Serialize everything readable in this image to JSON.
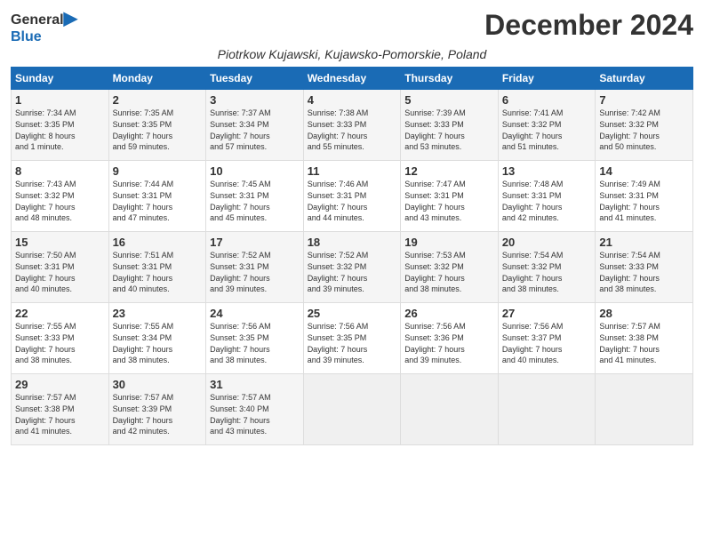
{
  "logo": {
    "line1": "General",
    "line2": "Blue"
  },
  "title": "December 2024",
  "location": "Piotrkow Kujawski, Kujawsko-Pomorskie, Poland",
  "days_of_week": [
    "Sunday",
    "Monday",
    "Tuesday",
    "Wednesday",
    "Thursday",
    "Friday",
    "Saturday"
  ],
  "weeks": [
    [
      {
        "day": "1",
        "info": "Sunrise: 7:34 AM\nSunset: 3:35 PM\nDaylight: 8 hours\nand 1 minute."
      },
      {
        "day": "2",
        "info": "Sunrise: 7:35 AM\nSunset: 3:35 PM\nDaylight: 7 hours\nand 59 minutes."
      },
      {
        "day": "3",
        "info": "Sunrise: 7:37 AM\nSunset: 3:34 PM\nDaylight: 7 hours\nand 57 minutes."
      },
      {
        "day": "4",
        "info": "Sunrise: 7:38 AM\nSunset: 3:33 PM\nDaylight: 7 hours\nand 55 minutes."
      },
      {
        "day": "5",
        "info": "Sunrise: 7:39 AM\nSunset: 3:33 PM\nDaylight: 7 hours\nand 53 minutes."
      },
      {
        "day": "6",
        "info": "Sunrise: 7:41 AM\nSunset: 3:32 PM\nDaylight: 7 hours\nand 51 minutes."
      },
      {
        "day": "7",
        "info": "Sunrise: 7:42 AM\nSunset: 3:32 PM\nDaylight: 7 hours\nand 50 minutes."
      }
    ],
    [
      {
        "day": "8",
        "info": "Sunrise: 7:43 AM\nSunset: 3:32 PM\nDaylight: 7 hours\nand 48 minutes."
      },
      {
        "day": "9",
        "info": "Sunrise: 7:44 AM\nSunset: 3:31 PM\nDaylight: 7 hours\nand 47 minutes."
      },
      {
        "day": "10",
        "info": "Sunrise: 7:45 AM\nSunset: 3:31 PM\nDaylight: 7 hours\nand 45 minutes."
      },
      {
        "day": "11",
        "info": "Sunrise: 7:46 AM\nSunset: 3:31 PM\nDaylight: 7 hours\nand 44 minutes."
      },
      {
        "day": "12",
        "info": "Sunrise: 7:47 AM\nSunset: 3:31 PM\nDaylight: 7 hours\nand 43 minutes."
      },
      {
        "day": "13",
        "info": "Sunrise: 7:48 AM\nSunset: 3:31 PM\nDaylight: 7 hours\nand 42 minutes."
      },
      {
        "day": "14",
        "info": "Sunrise: 7:49 AM\nSunset: 3:31 PM\nDaylight: 7 hours\nand 41 minutes."
      }
    ],
    [
      {
        "day": "15",
        "info": "Sunrise: 7:50 AM\nSunset: 3:31 PM\nDaylight: 7 hours\nand 40 minutes."
      },
      {
        "day": "16",
        "info": "Sunrise: 7:51 AM\nSunset: 3:31 PM\nDaylight: 7 hours\nand 40 minutes."
      },
      {
        "day": "17",
        "info": "Sunrise: 7:52 AM\nSunset: 3:31 PM\nDaylight: 7 hours\nand 39 minutes."
      },
      {
        "day": "18",
        "info": "Sunrise: 7:52 AM\nSunset: 3:32 PM\nDaylight: 7 hours\nand 39 minutes."
      },
      {
        "day": "19",
        "info": "Sunrise: 7:53 AM\nSunset: 3:32 PM\nDaylight: 7 hours\nand 38 minutes."
      },
      {
        "day": "20",
        "info": "Sunrise: 7:54 AM\nSunset: 3:32 PM\nDaylight: 7 hours\nand 38 minutes."
      },
      {
        "day": "21",
        "info": "Sunrise: 7:54 AM\nSunset: 3:33 PM\nDaylight: 7 hours\nand 38 minutes."
      }
    ],
    [
      {
        "day": "22",
        "info": "Sunrise: 7:55 AM\nSunset: 3:33 PM\nDaylight: 7 hours\nand 38 minutes."
      },
      {
        "day": "23",
        "info": "Sunrise: 7:55 AM\nSunset: 3:34 PM\nDaylight: 7 hours\nand 38 minutes."
      },
      {
        "day": "24",
        "info": "Sunrise: 7:56 AM\nSunset: 3:35 PM\nDaylight: 7 hours\nand 38 minutes."
      },
      {
        "day": "25",
        "info": "Sunrise: 7:56 AM\nSunset: 3:35 PM\nDaylight: 7 hours\nand 39 minutes."
      },
      {
        "day": "26",
        "info": "Sunrise: 7:56 AM\nSunset: 3:36 PM\nDaylight: 7 hours\nand 39 minutes."
      },
      {
        "day": "27",
        "info": "Sunrise: 7:56 AM\nSunset: 3:37 PM\nDaylight: 7 hours\nand 40 minutes."
      },
      {
        "day": "28",
        "info": "Sunrise: 7:57 AM\nSunset: 3:38 PM\nDaylight: 7 hours\nand 41 minutes."
      }
    ],
    [
      {
        "day": "29",
        "info": "Sunrise: 7:57 AM\nSunset: 3:38 PM\nDaylight: 7 hours\nand 41 minutes."
      },
      {
        "day": "30",
        "info": "Sunrise: 7:57 AM\nSunset: 3:39 PM\nDaylight: 7 hours\nand 42 minutes."
      },
      {
        "day": "31",
        "info": "Sunrise: 7:57 AM\nSunset: 3:40 PM\nDaylight: 7 hours\nand 43 minutes."
      },
      null,
      null,
      null,
      null
    ]
  ]
}
